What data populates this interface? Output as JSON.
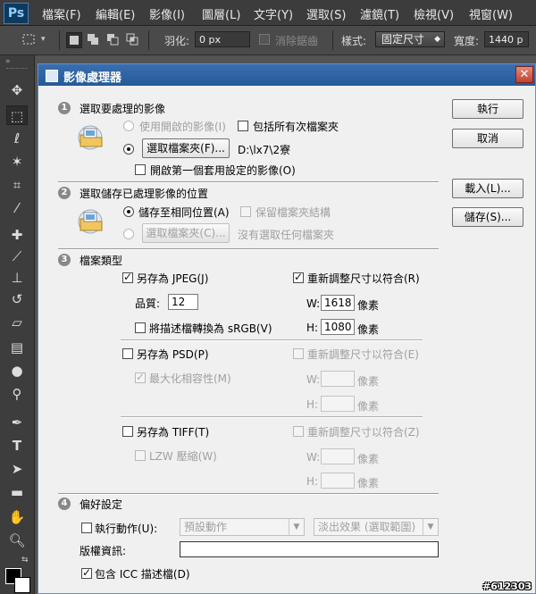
{
  "app": {
    "logo": "Ps"
  },
  "menu": [
    "檔案(F)",
    "編輯(E)",
    "影像(I)",
    "圖層(L)",
    "文字(Y)",
    "選取(S)",
    "濾鏡(T)",
    "檢視(V)",
    "視窗(W)"
  ],
  "options": {
    "feather_label": "羽化:",
    "feather_value": "0 px",
    "antialias_label": "消除鋸齒",
    "style_label": "樣式:",
    "style_value": "固定尺寸",
    "width_label": "寬度:",
    "width_value": "1440 p"
  },
  "dialog": {
    "title": "影像處理器",
    "close_glyph": "✕",
    "buttons": {
      "run": "執行",
      "cancel": "取消",
      "load": "載入(L)...",
      "save": "儲存(S)..."
    },
    "section1": {
      "number": "1",
      "heading": "選取要處理的影像",
      "use_open_images": "使用開啟的影像(I)",
      "include_subfolders": "包括所有次檔案夾",
      "select_folder_button": "選取檔案夾(F)...",
      "folder_path": "D:\\lx7\\2寮",
      "open_first_image": "開啟第一個套用設定的影像(O)"
    },
    "section2": {
      "number": "2",
      "heading": "選取儲存已處理影像的位置",
      "save_same_location": "儲存至相同位置(A)",
      "keep_folder_structure": "保留檔案夾結構",
      "select_folder_button": "選取檔案夾(C)...",
      "no_folder_selected": "沒有選取任何檔案夾"
    },
    "section3": {
      "number": "3",
      "heading": "檔案類型",
      "jpeg": {
        "save_as": "另存為 JPEG(J)",
        "resize": "重新調整尺寸以符合(R)",
        "quality_label": "品質:",
        "quality_value": "12",
        "w_label": "W:",
        "w_value": "1618",
        "w_unit": "像素",
        "h_label": "H:",
        "h_value": "1080",
        "h_unit": "像素",
        "convert_srgb": "將描述檔轉換為 sRGB(V)"
      },
      "psd": {
        "save_as": "另存為 PSD(P)",
        "resize": "重新調整尺寸以符合(E)",
        "maximize": "最大化相容性(M)",
        "w_label": "W:",
        "w_unit": "像素",
        "h_label": "H:",
        "h_unit": "像素"
      },
      "tiff": {
        "save_as": "另存為 TIFF(T)",
        "resize": "重新調整尺寸以符合(Z)",
        "lzw": "LZW 壓縮(W)",
        "w_label": "W:",
        "w_unit": "像素",
        "h_label": "H:",
        "h_unit": "像素"
      }
    },
    "section4": {
      "number": "4",
      "heading": "偏好設定",
      "run_action": "執行動作(U):",
      "action_set": "預設動作",
      "action_name": "淡出效果 (選取範圍)",
      "copyright_label": "版權資訊:",
      "copyright_value": "",
      "include_icc": "包含 ICC 描述檔(D)"
    }
  },
  "watermark": "#612303"
}
